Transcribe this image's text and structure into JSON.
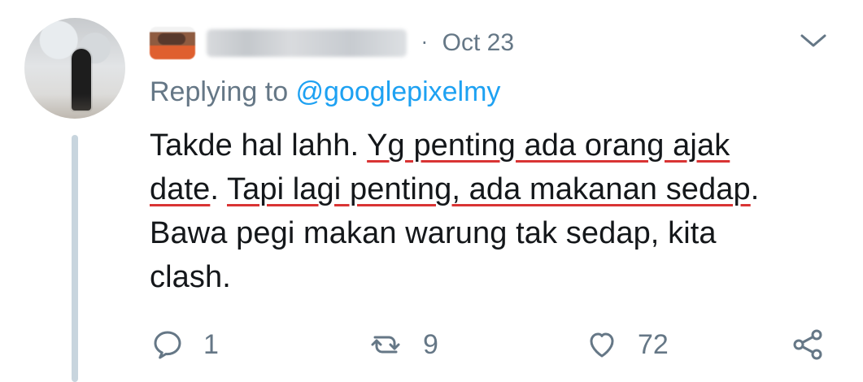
{
  "tweet": {
    "date": "Oct 23",
    "reply_prefix": "Replying to ",
    "reply_handle": "@googlepixelmy",
    "text_lines": {
      "line1_a": "Takde hal lahh. ",
      "line1_b": "Yg penting ada orang ajak",
      "line2_a": "date",
      "line2_b": ". ",
      "line2_c": "Tapi lagi penting, ada makanan sedap",
      "line2_d": ".",
      "line3": "Bawa pegi makan warung tak sedap, kita",
      "line4": "clash."
    },
    "actions": {
      "reply_count": "1",
      "retweet_count": "9",
      "like_count": "72"
    }
  },
  "icons": {
    "menu": "chevron-down-icon",
    "reply": "reply-icon",
    "retweet": "retweet-icon",
    "like": "heart-icon",
    "share": "share-icon"
  },
  "colors": {
    "text": "#14171a",
    "muted": "#657786",
    "link": "#1da1f2",
    "thread_line": "#c8d5de",
    "highlight": "#d93434"
  }
}
